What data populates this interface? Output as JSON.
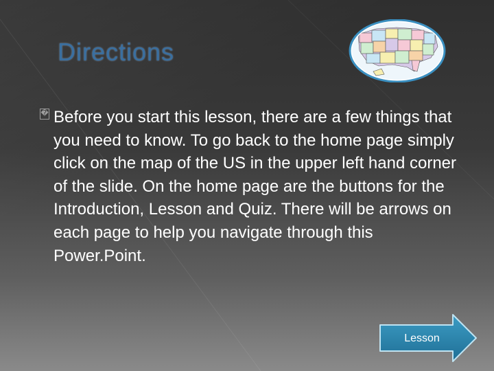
{
  "slide": {
    "title": "Directions",
    "bullet_glyph": "�",
    "body": "Before you start this lesson, there are a few things that you need to know. To go back to the home page simply click on the map of the US in the upper left hand corner of the slide. On the home page are the buttons for the Introduction, Lesson and Quiz. There will be arrows on each page to help you navigate through this Power.Point.",
    "map_icon": "us-map-icon",
    "next_button": {
      "label": "Lesson",
      "icon": "arrow-right-icon",
      "color": "#2a7fa8"
    }
  },
  "colors": {
    "title": "#3a6fa0",
    "text": "#ffffff",
    "bullet": "#9e9e9e"
  }
}
